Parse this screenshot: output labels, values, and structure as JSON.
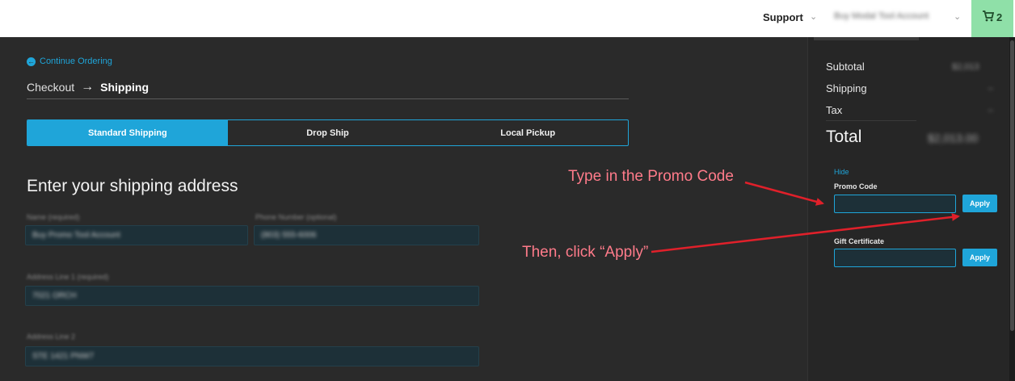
{
  "header": {
    "support_label": "Support",
    "account_label": "Buy Modal Tool Account",
    "cart_count": "2"
  },
  "nav": {
    "continue_label": "Continue Ordering",
    "breadcrumb_parent": "Checkout",
    "breadcrumb_current": "Shipping"
  },
  "tabs": [
    {
      "label": "Standard Shipping",
      "active": true
    },
    {
      "label": "Drop Ship",
      "active": false
    },
    {
      "label": "Local Pickup",
      "active": false
    }
  ],
  "form": {
    "heading": "Enter your shipping address",
    "name_label": "Name (required)",
    "name_value": "Buy Promo Tool Account",
    "phone_label": "Phone Number (optional)",
    "phone_value": "(803) 555-6006",
    "address1_label": "Address Line 1 (required)",
    "address1_value": "7021 ORCH",
    "address2_label": "Address Line 2",
    "address2_value": "STE 1421 PNW7"
  },
  "summary": {
    "subtotal_label": "Subtotal",
    "subtotal_value": "$2,013",
    "shipping_label": "Shipping",
    "shipping_value": "--",
    "tax_label": "Tax",
    "tax_value": "--",
    "total_label": "Total",
    "total_value": "$2,013.00"
  },
  "promo": {
    "hide_label": "Hide",
    "promo_label": "Promo Code",
    "promo_apply": "Apply",
    "gift_label": "Gift Certificate",
    "gift_apply": "Apply"
  },
  "annotations": {
    "type_promo": "Type in the Promo Code",
    "click_apply": "Then, click “Apply”",
    "color": "#ff7b8a",
    "arrow_color": "#e0202a"
  },
  "colors": {
    "accent": "#1fa5d9",
    "cart_bg": "#8fe0a8",
    "background": "#2a2a2a"
  }
}
